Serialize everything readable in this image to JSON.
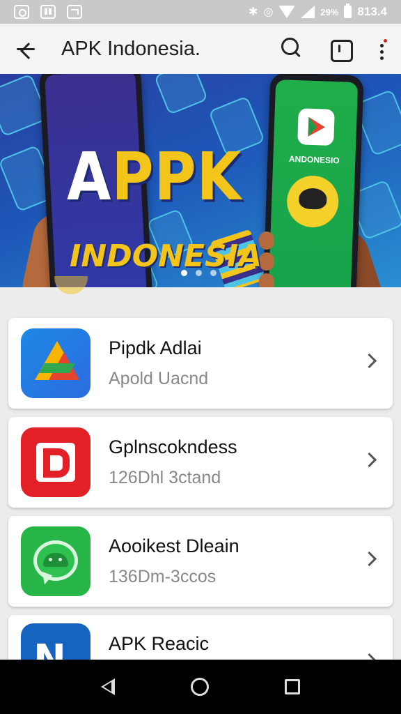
{
  "status_bar": {
    "battery_percent": "29%",
    "time": "813.4",
    "icons": [
      "notification-icon",
      "notification-icon",
      "notification-icon",
      "bluetooth-icon",
      "vibrate-icon",
      "wifi-icon",
      "signal-icon",
      "battery-icon"
    ]
  },
  "app_bar": {
    "title": "APK Indonesia.",
    "actions": [
      "search-icon",
      "square-icon",
      "more-vert-icon"
    ],
    "notification_dot_color": "#e02020"
  },
  "banner": {
    "headline_prefix": "A",
    "headline_accent": "PPK",
    "subline": "INDONESIA",
    "phone_caption": "ANDONESIO",
    "page_indicator": {
      "pages": 3,
      "current": 1
    },
    "colors": {
      "background": "#1d57b8",
      "accent": "#f3c419"
    }
  },
  "apps": [
    {
      "name": "Pipdk Adlai",
      "subtitle": "Apold Uacnd",
      "icon": "drive-icon"
    },
    {
      "name": "Gplnscokndess",
      "subtitle": "126Dhl 3ctand",
      "icon": "p-logo-icon"
    },
    {
      "name": "Aooikest Dleain",
      "subtitle": "136Dm-3ccos",
      "icon": "android-chat-icon"
    },
    {
      "name": "APK Reacic",
      "subtitle": "",
      "icon": "n-logo-icon"
    }
  ],
  "nav_bar": {
    "buttons": [
      "back-icon",
      "home-icon",
      "recents-icon"
    ]
  }
}
